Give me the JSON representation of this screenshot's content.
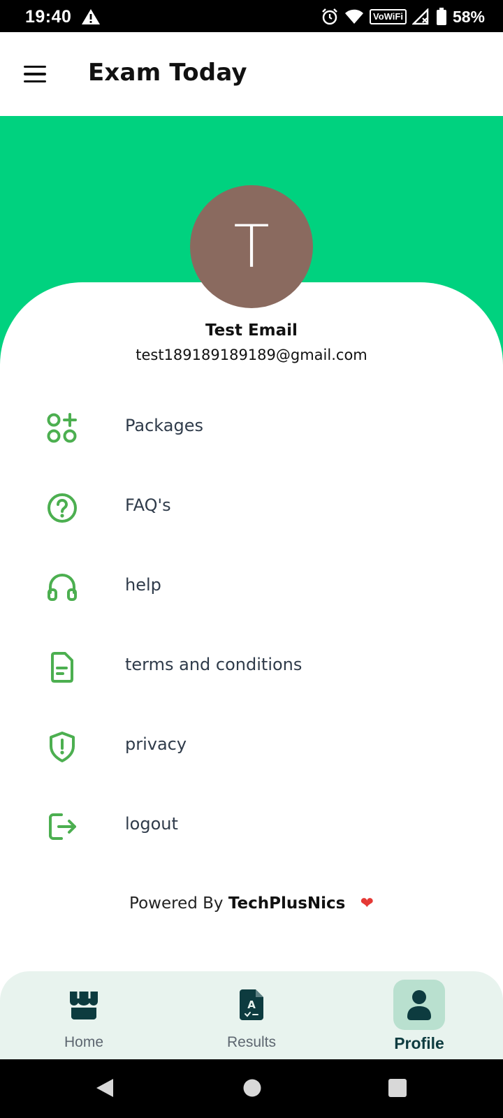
{
  "status_bar": {
    "time": "19:40",
    "network_badge": "VoWiFi",
    "battery_percent": "58%",
    "icons": [
      "warning-icon",
      "alarm-icon",
      "wifi-icon",
      "signal-icon",
      "battery-icon"
    ]
  },
  "app_bar": {
    "title": "Exam Today"
  },
  "profile": {
    "avatar_initial": "T",
    "name": "Test Email",
    "email": "test189189189189@gmail.com"
  },
  "menu": {
    "items": [
      {
        "label": "Packages",
        "icon": "packages-icon"
      },
      {
        "label": "FAQ's",
        "icon": "question-circle-icon"
      },
      {
        "label": "help",
        "icon": "headphones-icon"
      },
      {
        "label": "terms and conditions",
        "icon": "document-icon"
      },
      {
        "label": "privacy",
        "icon": "shield-alert-icon"
      },
      {
        "label": "logout",
        "icon": "logout-icon"
      }
    ]
  },
  "footer": {
    "powered_prefix": "Powered By",
    "powered_brand": "TechPlusNics",
    "heart": "❤"
  },
  "bottom_nav": {
    "items": [
      {
        "label": "Home",
        "icon": "store-icon",
        "active": false
      },
      {
        "label": "Results",
        "icon": "result-document-icon",
        "active": false
      },
      {
        "label": "Profile",
        "icon": "person-icon",
        "active": true
      }
    ]
  },
  "colors": {
    "header_green": "#00d27f",
    "icon_green": "#4caf50",
    "avatar_bg": "#8a6a5f",
    "nav_bg": "#e8f3ee",
    "nav_active_bg": "#b9e0cf",
    "nav_icon": "#0d3b3f"
  }
}
